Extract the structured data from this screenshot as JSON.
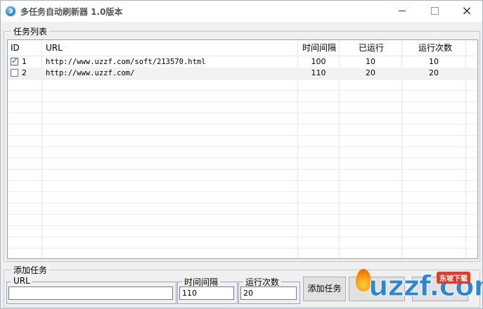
{
  "window": {
    "title": "多任务自动刷新器 1.0版本",
    "icon": "refresh-app-icon",
    "controls": {
      "minimize": "minimize-icon",
      "maximize": "maximize-icon",
      "close": "×"
    }
  },
  "task_list": {
    "legend": "任务列表",
    "columns": [
      "ID",
      "URL",
      "时间间隔",
      "已运行",
      "运行次数"
    ],
    "rows": [
      {
        "checked": true,
        "id": "1",
        "url": "http://www.uzzf.com/soft/213570.html",
        "interval": "100",
        "run_count": "10",
        "total_runs": "10"
      },
      {
        "checked": false,
        "id": "2",
        "url": "http://www.uzzf.com/",
        "interval": "110",
        "run_count": "20",
        "total_runs": "20"
      }
    ]
  },
  "add_task": {
    "legend": "添加任务",
    "url_label": "URL",
    "url_value": "",
    "interval_label": "时间间隔",
    "interval_value": "110",
    "runs_label": "运行次数",
    "runs_value": "20",
    "add_button": "添加任务"
  },
  "watermark": {
    "text": "uzzf.com",
    "badge": "东坡下载"
  },
  "colors": {
    "accent": "#2a86d6",
    "selected_row": "#f2f2f2",
    "border": "#a0a0a0"
  }
}
